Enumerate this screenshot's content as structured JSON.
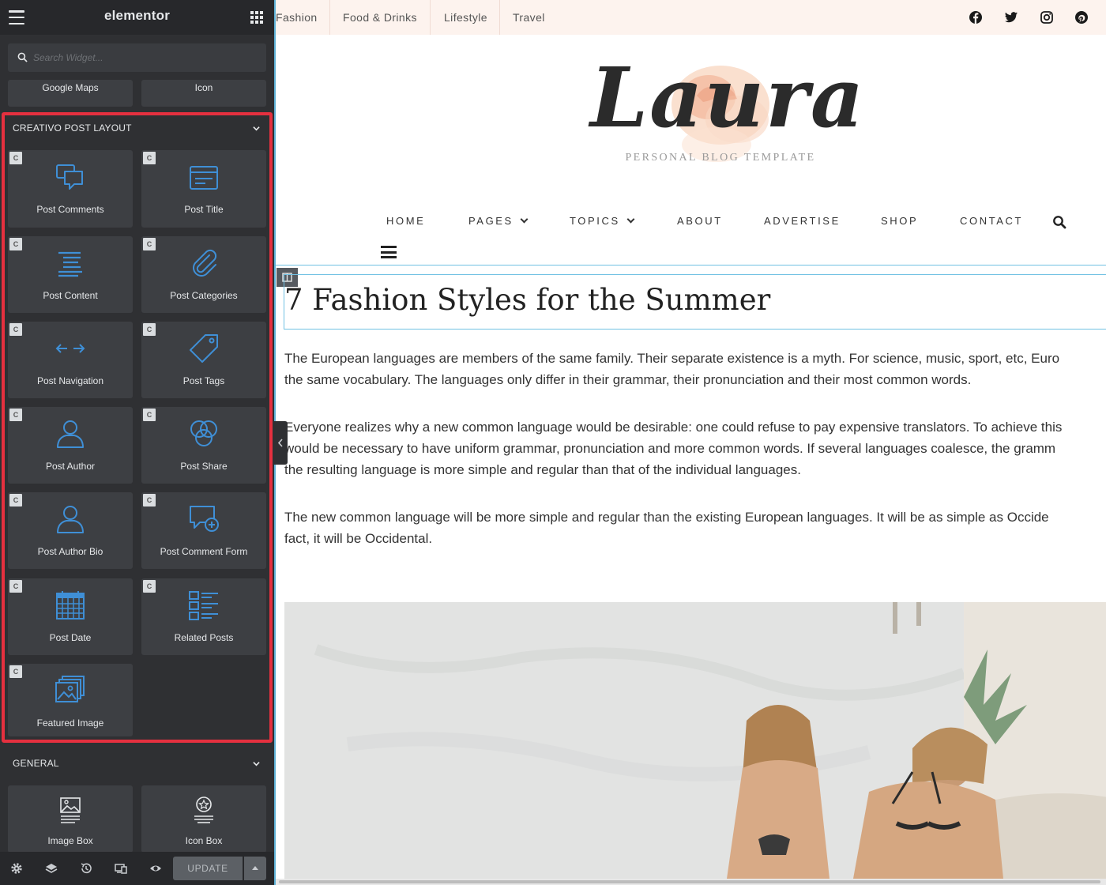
{
  "panel": {
    "title": "elementor",
    "search_placeholder": "Search Widget...",
    "prev_widgets": [
      "Google Maps",
      "Icon"
    ],
    "sections": {
      "creativo": {
        "title": "CREATIVO POST LAYOUT",
        "badge": "C",
        "widgets": [
          {
            "label": "Post Comments",
            "icon": "comments-icon"
          },
          {
            "label": "Post Title",
            "icon": "title-icon"
          },
          {
            "label": "Post Content",
            "icon": "content-icon"
          },
          {
            "label": "Post Categories",
            "icon": "paperclip-icon"
          },
          {
            "label": "Post Navigation",
            "icon": "arrows-icon"
          },
          {
            "label": "Post Tags",
            "icon": "tag-icon"
          },
          {
            "label": "Post Author",
            "icon": "user-icon"
          },
          {
            "label": "Post Share",
            "icon": "share-circles-icon"
          },
          {
            "label": "Post Author Bio",
            "icon": "user-icon"
          },
          {
            "label": "Post Comment Form",
            "icon": "comment-plus-icon"
          },
          {
            "label": "Post Date",
            "icon": "calendar-icon"
          },
          {
            "label": "Related Posts",
            "icon": "list-icon"
          },
          {
            "label": "Featured Image",
            "icon": "images-icon"
          }
        ]
      },
      "general": {
        "title": "GENERAL",
        "widgets": [
          {
            "label": "Image Box",
            "icon": "image-box-icon"
          },
          {
            "label": "Icon Box",
            "icon": "icon-box-icon"
          }
        ]
      }
    },
    "footer": {
      "update_label": "UPDATE",
      "icons": [
        "gear-icon",
        "layers-icon",
        "history-icon",
        "responsive-icon",
        "eye-icon"
      ]
    },
    "colors": {
      "panel_bg": "#2f3033",
      "tile_bg": "#3d3f43",
      "icon_blue": "#3f8fd6",
      "highlight": "#e5303f"
    }
  },
  "site": {
    "topbar": {
      "links": [
        "Fashion",
        "Food & Drinks",
        "Lifestyle",
        "Travel"
      ],
      "social": [
        "facebook-icon",
        "twitter-icon",
        "instagram-icon",
        "pinterest-icon"
      ]
    },
    "logo": {
      "text": "Laura",
      "tagline": "PERSONAL BLOG TEMPLATE"
    },
    "nav": [
      "HOME",
      "PAGES",
      "TOPICS",
      "ABOUT",
      "ADVERTISE",
      "SHOP",
      "CONTACT"
    ],
    "post": {
      "title": "7 Fashion Styles for the Summer",
      "paragraphs": [
        [
          "The European languages are members of the same family. Their separate existence is a myth. For science, music, sport, etc, Euro",
          "the same vocabulary. The languages only differ in their grammar, their pronunciation and their most common words."
        ],
        [
          "Everyone realizes why a new common language would be desirable: one could refuse to pay expensive translators. To achieve this",
          "would be necessary to have uniform grammar, pronunciation and more common words. If several languages coalesce, the gramm",
          "the resulting language is more simple and regular than that of the individual languages."
        ],
        [
          "The new common language will be more simple and regular than the existing European languages. It will be as simple as Occide",
          "fact, it will be Occidental."
        ]
      ]
    }
  }
}
